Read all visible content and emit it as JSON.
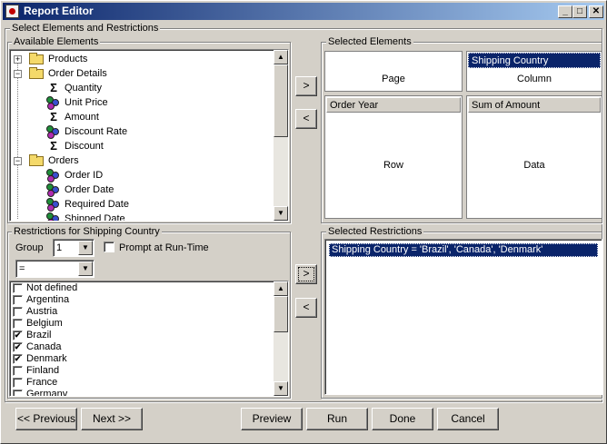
{
  "window": {
    "title": "Report Editor",
    "controls": {
      "minimize": "_",
      "maximize": "□",
      "close": "✕"
    }
  },
  "main_group": {
    "label": "Select Elements and Restrictions"
  },
  "available": {
    "label": "Available Elements",
    "items": [
      {
        "label": "Products",
        "type": "folder",
        "expander": "+",
        "level": 0
      },
      {
        "label": "Order Details",
        "type": "folder",
        "expander": "−",
        "level": 0
      },
      {
        "label": "Quantity",
        "type": "measure",
        "level": 1
      },
      {
        "label": "Unit Price",
        "type": "dimension",
        "level": 1
      },
      {
        "label": "Amount",
        "type": "measure",
        "level": 1
      },
      {
        "label": "Discount Rate",
        "type": "dimension",
        "level": 1
      },
      {
        "label": "Discount",
        "type": "measure",
        "level": 1
      },
      {
        "label": "Orders",
        "type": "folder",
        "expander": "−",
        "level": 0
      },
      {
        "label": "Order ID",
        "type": "dimension",
        "level": 1
      },
      {
        "label": "Order Date",
        "type": "dimension",
        "level": 1
      },
      {
        "label": "Required Date",
        "type": "dimension",
        "level": 1
      },
      {
        "label": "Shipped Date",
        "type": "dimension",
        "level": 1
      }
    ]
  },
  "selected": {
    "label": "Selected Elements",
    "page": {
      "label": "Page",
      "header": ""
    },
    "column": {
      "label": "Column",
      "header": "Shipping Country"
    },
    "row": {
      "label": "Row",
      "header": "Order Year"
    },
    "data": {
      "label": "Data",
      "header": "Sum of Amount"
    }
  },
  "move_buttons": {
    "add": ">",
    "remove": "<"
  },
  "restrictions": {
    "label": "Restrictions for Shipping Country",
    "group_label": "Group",
    "group_value": "1",
    "prompt_label": "Prompt at Run-Time",
    "prompt_checked": false,
    "operator": "=",
    "values": [
      {
        "label": "Not defined",
        "checked": false
      },
      {
        "label": "Argentina",
        "checked": false
      },
      {
        "label": "Austria",
        "checked": false
      },
      {
        "label": "Belgium",
        "checked": false
      },
      {
        "label": "Brazil",
        "checked": true
      },
      {
        "label": "Canada",
        "checked": true
      },
      {
        "label": "Denmark",
        "checked": true
      },
      {
        "label": "Finland",
        "checked": false
      },
      {
        "label": "France",
        "checked": false
      },
      {
        "label": "Germany",
        "checked": false
      }
    ]
  },
  "selected_restrictions": {
    "label": "Selected Restrictions",
    "items": [
      "Shipping Country = 'Brazil', 'Canada', 'Denmark'"
    ]
  },
  "footer": {
    "previous": "<< Previous",
    "next": "Next >>",
    "preview": "Preview",
    "run": "Run",
    "done": "Done",
    "cancel": "Cancel"
  },
  "scroll_arrows": {
    "up": "▲",
    "down": "▼"
  },
  "check_mark": "✔"
}
